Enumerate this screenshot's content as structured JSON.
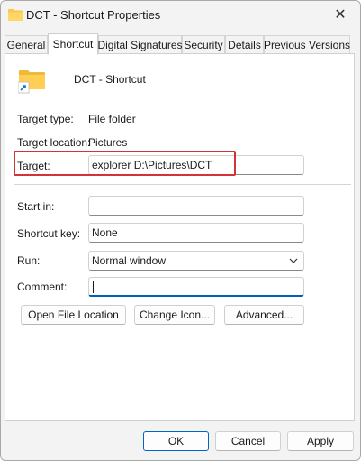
{
  "window": {
    "title": "DCT - Shortcut Properties",
    "close_glyph": "✕"
  },
  "tabs": [
    {
      "label": "General",
      "active": false
    },
    {
      "label": "Shortcut",
      "active": true
    },
    {
      "label": "Digital Signatures",
      "active": false
    },
    {
      "label": "Security",
      "active": false
    },
    {
      "label": "Details",
      "active": false
    },
    {
      "label": "Previous Versions",
      "active": false
    }
  ],
  "shortcut": {
    "name": "DCT - Shortcut",
    "icon": "folder-shortcut-icon",
    "target_type_label": "Target type:",
    "target_type_value": "File folder",
    "target_location_label": "Target location:",
    "target_location_value": "Pictures",
    "target_label": "Target:",
    "target_value": "explorer D:\\Pictures\\DCT",
    "start_in_label": "Start in:",
    "start_in_value": "",
    "shortcut_key_label": "Shortcut key:",
    "shortcut_key_value": "None",
    "run_label": "Run:",
    "run_value": "Normal window",
    "comment_label": "Comment:",
    "comment_value": ""
  },
  "actions": {
    "open_file_location": "Open File Location",
    "change_icon": "Change Icon...",
    "advanced": "Advanced..."
  },
  "footer": {
    "ok": "OK",
    "cancel": "Cancel",
    "apply": "Apply"
  },
  "colors": {
    "highlight_border": "#d13438",
    "accent": "#005fb8",
    "folder": "#f8c94a"
  }
}
